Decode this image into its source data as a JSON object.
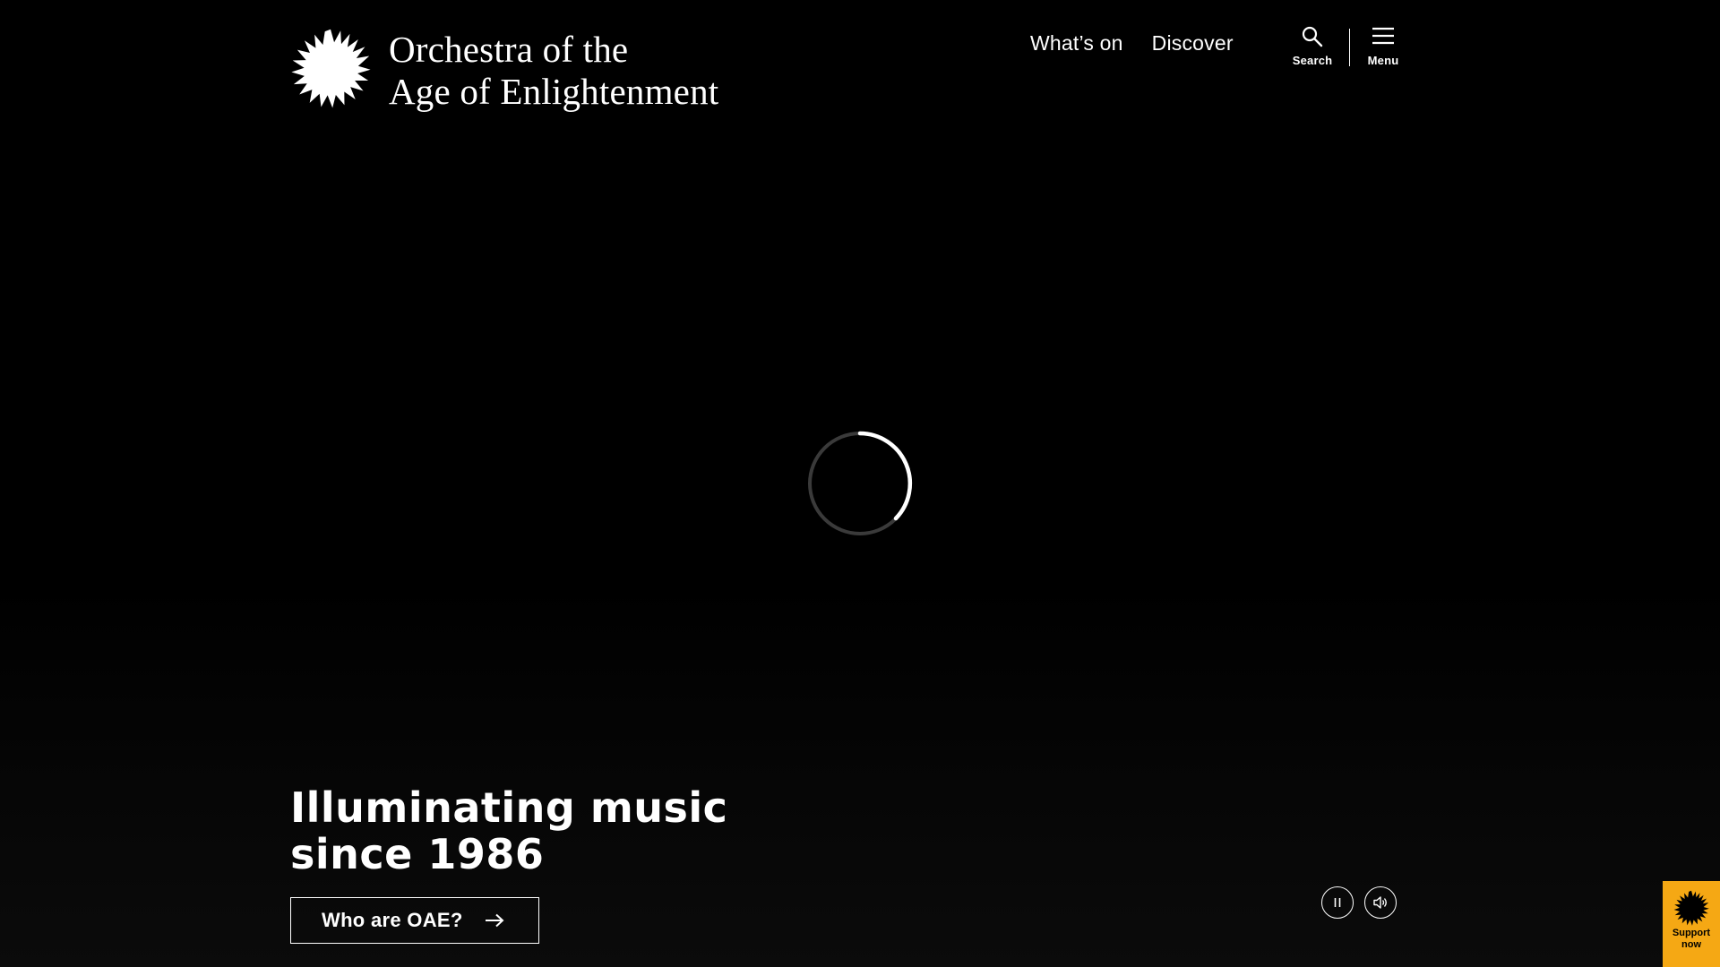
{
  "header": {
    "logo": {
      "line1": "Orchestra of the",
      "line2": "Age of Enlightenment",
      "icon": "sun-icon"
    },
    "nav": [
      {
        "label": "What’s on"
      },
      {
        "label": "Discover"
      }
    ],
    "search_label": "Search",
    "menu_label": "Menu"
  },
  "hero": {
    "title": "Illuminating music since 1986",
    "cta_label": "Who are OAE?"
  },
  "media_controls": {
    "pause_icon": "pause-icon",
    "sound_icon": "speaker-icon"
  },
  "support": {
    "label": "Support now",
    "color": "#f5a814"
  },
  "loading": {
    "icon": "loading-spinner-icon"
  }
}
